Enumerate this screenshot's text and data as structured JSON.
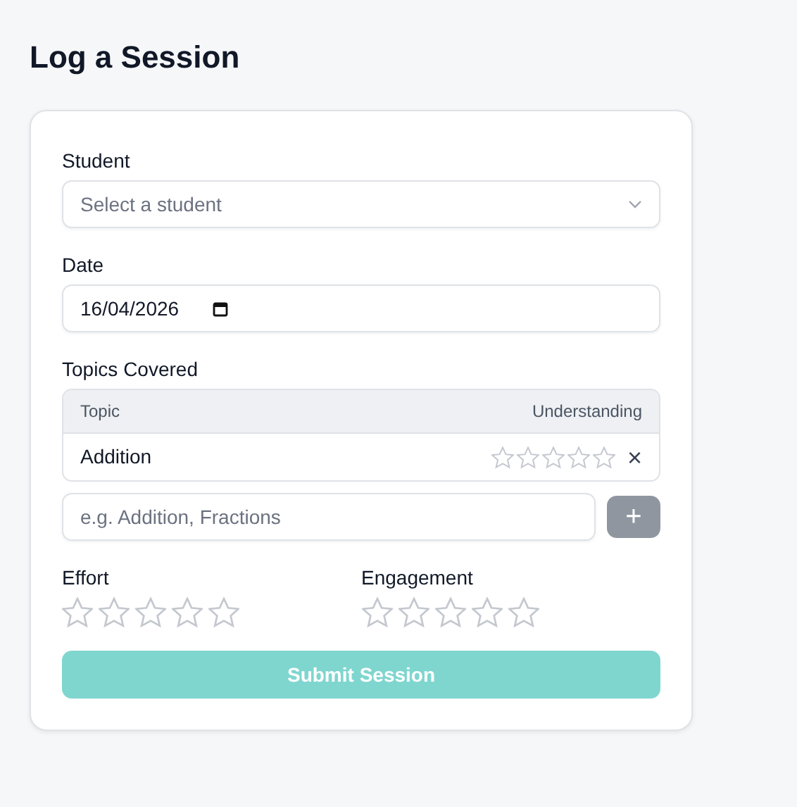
{
  "page": {
    "title": "Log a Session"
  },
  "student": {
    "label": "Student",
    "placeholder": "Select a student"
  },
  "date": {
    "label": "Date",
    "value": "16/04/2026"
  },
  "topics": {
    "label": "Topics Covered",
    "columns": [
      "Topic",
      "Understanding"
    ],
    "rows": [
      {
        "name": "Addition",
        "stars": 0,
        "remove": "×"
      }
    ],
    "input": {
      "placeholder": "e.g. Addition, Fractions"
    },
    "add_button": {
      "label": "+",
      "disabled": true
    }
  },
  "ratings": [
    {
      "label": "Effort",
      "stars": 0
    },
    {
      "label": "Engagement",
      "stars": 0
    }
  ],
  "submit": {
    "label": "Submit Session",
    "disabled": true
  }
}
